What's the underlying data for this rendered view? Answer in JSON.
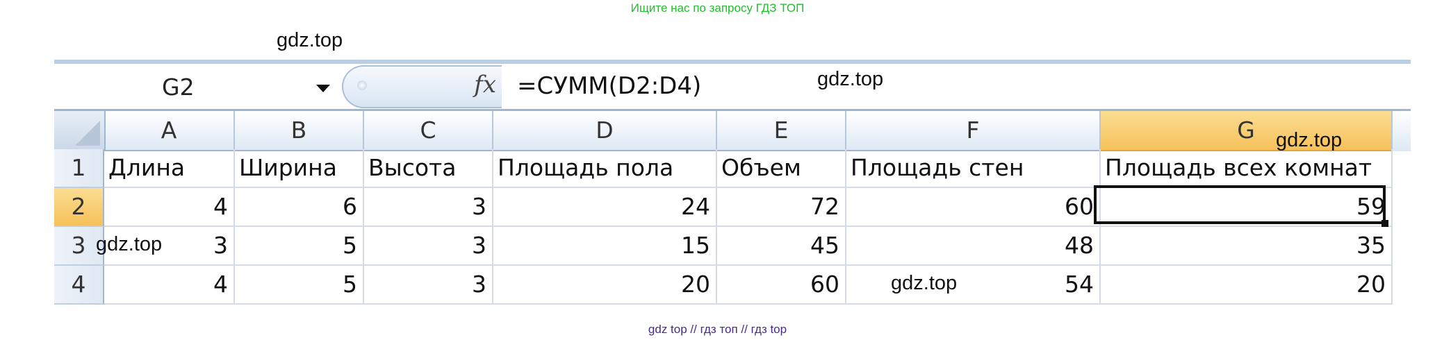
{
  "banners": {
    "top": "Ищите нас по запросу ГДЗ ТОП",
    "bottom": "gdz top  //  гдз топ  //  гдз top"
  },
  "watermark": "gdz.top",
  "formula_bar": {
    "name_box": "G2",
    "fx_icon": "fx-icon",
    "formula": "=СУММ(D2:D4)"
  },
  "columns": [
    "A",
    "B",
    "C",
    "D",
    "E",
    "F",
    "G"
  ],
  "selected_column": "G",
  "rows": [
    {
      "num": "1",
      "cells": [
        "Длина",
        "Ширина",
        "Высота",
        "Площадь пола",
        "Объем",
        "Площадь стен",
        "Площадь всех комнат"
      ]
    },
    {
      "num": "2",
      "cells": [
        "4",
        "6",
        "3",
        "24",
        "72",
        "60",
        "59"
      ]
    },
    {
      "num": "3",
      "cells": [
        "3",
        "5",
        "3",
        "15",
        "45",
        "48",
        "35"
      ]
    },
    {
      "num": "4",
      "cells": [
        "4",
        "5",
        "3",
        "20",
        "60",
        "54",
        "20"
      ]
    }
  ],
  "active_cell": "G2",
  "colors": {
    "selection": "#f6c15a",
    "header": "#dde8f5",
    "banner_top": "#1fbf2b",
    "banner_bottom": "#4b2a86"
  }
}
